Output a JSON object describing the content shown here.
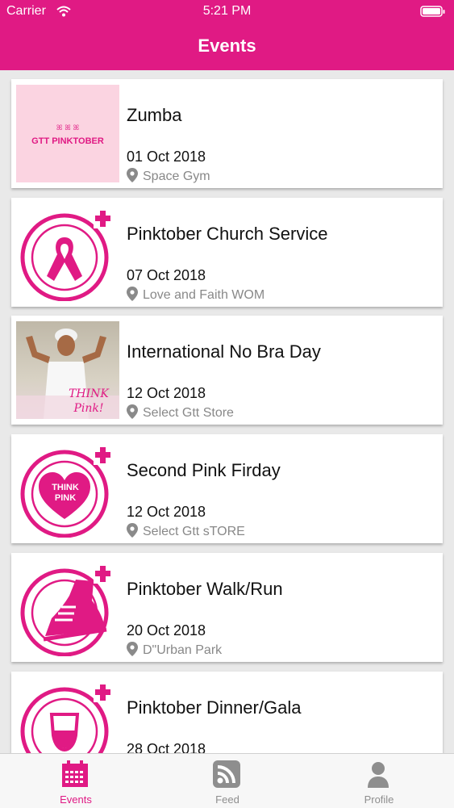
{
  "status_bar": {
    "carrier": "Carrier",
    "time": "5:21 PM"
  },
  "header": {
    "title": "Events"
  },
  "events": [
    {
      "name": "Zumba",
      "date": "01 Oct 2018",
      "venue": "Space Gym",
      "thumb_text": "GTT PINKTOBER",
      "icon": "gtt-pinktober-logo"
    },
    {
      "name": "Pinktober Church Service",
      "date": "07 Oct 2018",
      "venue": "Love and Faith WOM",
      "icon": "pink-ribbon-icon"
    },
    {
      "name": "International No Bra Day",
      "date": "12 Oct 2018",
      "venue": "Select Gtt Store",
      "thumb_text": "THINK Pink!",
      "icon": "photo"
    },
    {
      "name": "Second Pink Firday",
      "date": "12 Oct 2018",
      "venue": "Select Gtt sTORE",
      "thumb_text": "THINK PINK",
      "icon": "think-pink-heart-icon"
    },
    {
      "name": "Pinktober Walk/Run",
      "date": "20 Oct 2018",
      "venue": "D\"Urban Park",
      "icon": "running-shoe-icon"
    },
    {
      "name": "Pinktober Dinner/Gala",
      "date": "28 Oct 2018",
      "venue": "",
      "icon": "wine-glass-icon"
    }
  ],
  "tabs": [
    {
      "label": "Events",
      "icon": "calendar-icon",
      "active": true
    },
    {
      "label": "Feed",
      "icon": "rss-icon",
      "active": false
    },
    {
      "label": "Profile",
      "icon": "person-icon",
      "active": false
    }
  ],
  "colors": {
    "accent": "#e01a84",
    "background": "#e9e9e9",
    "muted": "#888888"
  }
}
